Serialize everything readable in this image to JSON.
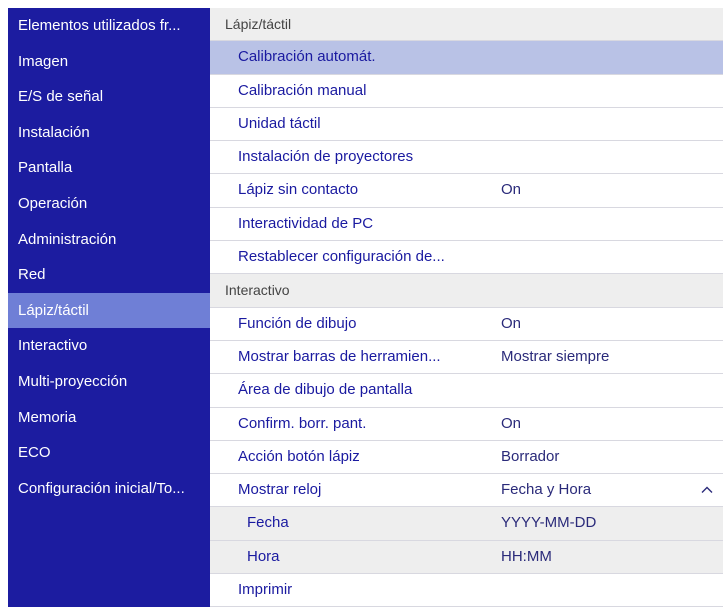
{
  "sidebar": {
    "items": [
      {
        "label": "Elementos utilizados fr..."
      },
      {
        "label": "Imagen"
      },
      {
        "label": "E/S de señal"
      },
      {
        "label": "Instalación"
      },
      {
        "label": "Pantalla"
      },
      {
        "label": "Operación"
      },
      {
        "label": "Administración"
      },
      {
        "label": "Red"
      },
      {
        "label": "Lápiz/táctil",
        "active": true
      },
      {
        "label": "Interactivo"
      },
      {
        "label": "Multi-proyección"
      },
      {
        "label": "Memoria"
      },
      {
        "label": "ECO"
      },
      {
        "label": "Configuración inicial/To..."
      }
    ]
  },
  "main": {
    "section1": {
      "header": "Lápiz/táctil",
      "rows": [
        {
          "label": "Calibración automát.",
          "value": ""
        },
        {
          "label": "Calibración manual",
          "value": ""
        },
        {
          "label": "Unidad táctil",
          "value": ""
        },
        {
          "label": "Instalación de proyectores",
          "value": ""
        },
        {
          "label": "Lápiz sin contacto",
          "value": "On"
        },
        {
          "label": "Interactividad de PC",
          "value": ""
        },
        {
          "label": "Restablecer configuración de...",
          "value": ""
        }
      ]
    },
    "section2": {
      "header": "Interactivo",
      "rows": [
        {
          "label": "Función de dibujo",
          "value": "On"
        },
        {
          "label": "Mostrar barras de herramien...",
          "value": "Mostrar siempre"
        },
        {
          "label": "Área de dibujo de pantalla",
          "value": ""
        },
        {
          "label": "Confirm. borr. pant.",
          "value": "On"
        },
        {
          "label": "Acción botón lápiz",
          "value": "Borrador"
        },
        {
          "label": "Mostrar reloj",
          "value": "Fecha y Hora"
        },
        {
          "label": "Fecha",
          "value": "YYYY-MM-DD"
        },
        {
          "label": "Hora",
          "value": "HH:MM"
        },
        {
          "label": "Imprimir",
          "value": ""
        }
      ]
    },
    "clock_expanded_icon": "chevron-up-icon"
  },
  "colors": {
    "sidebar_bg": "#1c1ca0",
    "sidebar_active": "#6f7fd6",
    "row_selected": "#b9c2e6",
    "row_text": "#1a1aa0"
  }
}
